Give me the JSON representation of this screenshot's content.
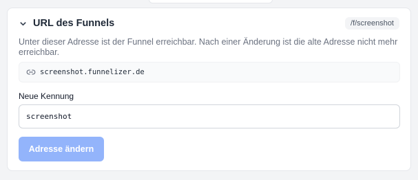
{
  "section": {
    "title": "URL des Funnels",
    "path_badge": "/f/screenshot",
    "description": "Unter dieser Adresse ist der Funnel erreichbar. Nach einer Änderung ist die alte Adresse nicht mehr erreichbar.",
    "current_url": "screenshot.funnelizer.de"
  },
  "form": {
    "label": "Neue Kennung",
    "value": "screenshot",
    "submit_label": "Adresse ändern",
    "submit_enabled": false
  },
  "icons": {
    "collapse": "chevron-down-icon",
    "link": "link-icon"
  },
  "colors": {
    "button_disabled": "#93b4fb",
    "card_bg": "#ffffff",
    "page_bg": "#f3f4f6"
  }
}
